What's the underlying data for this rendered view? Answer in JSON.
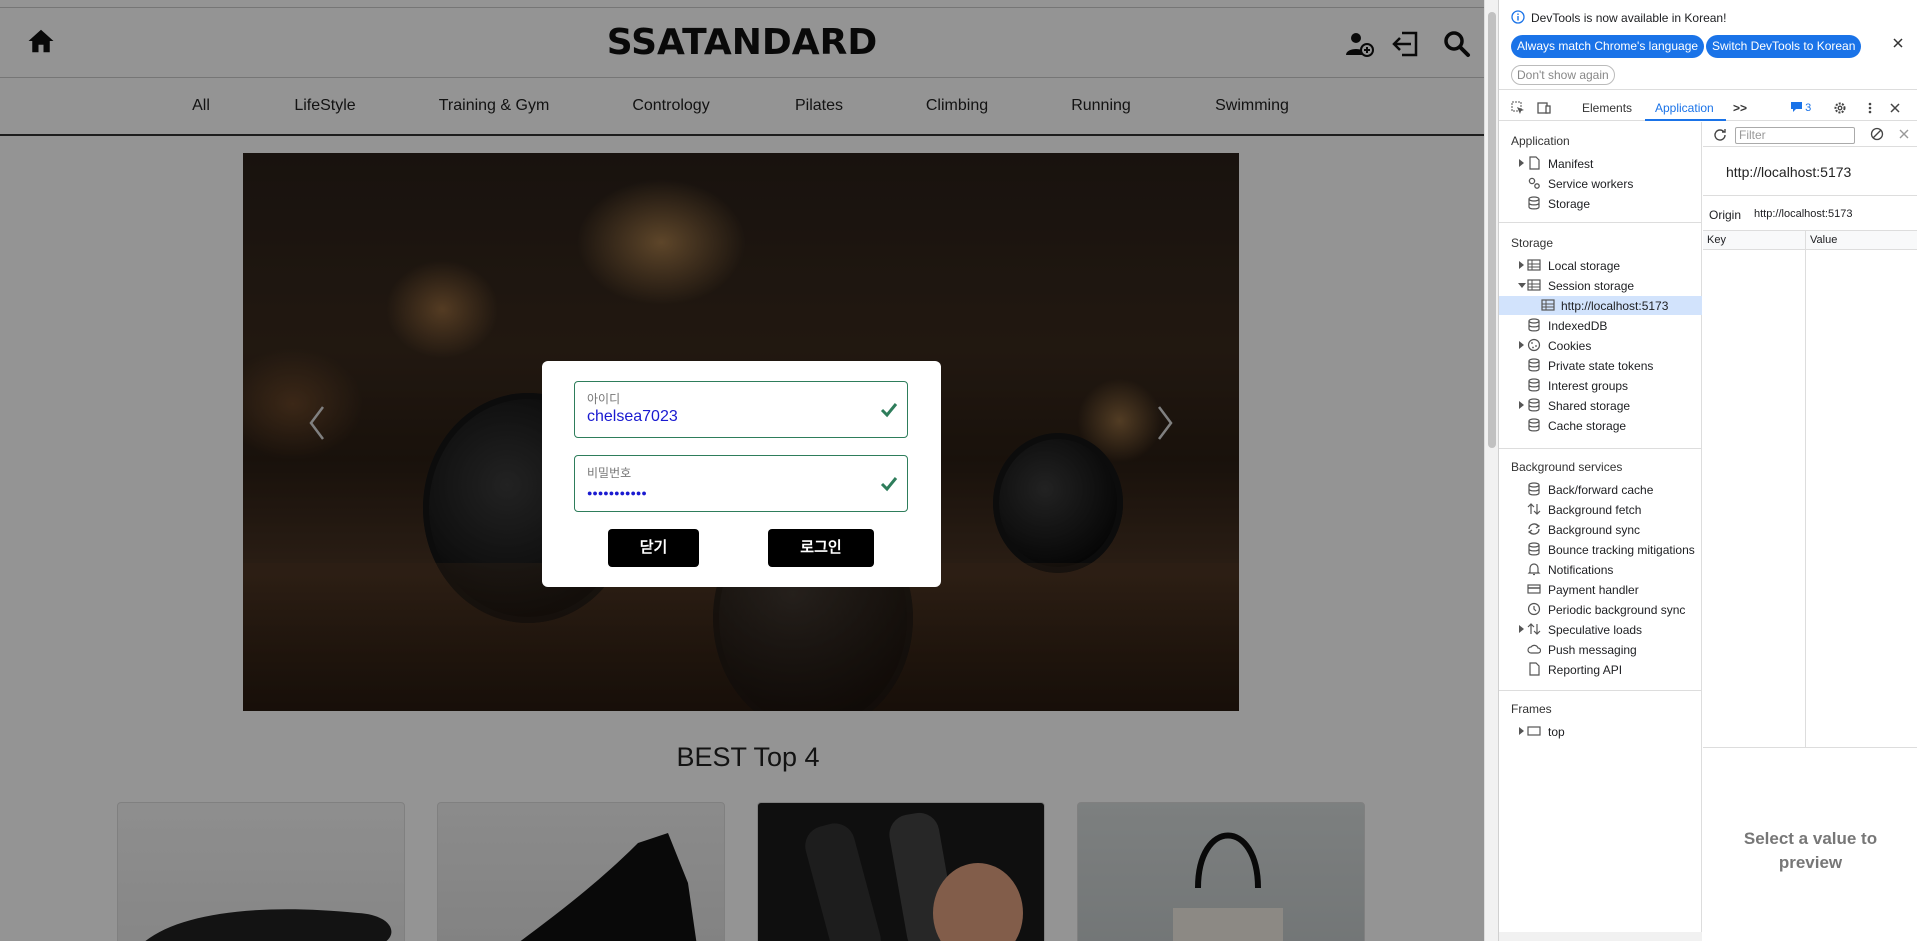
{
  "site": {
    "logo": "SSATANDARD",
    "nav": [
      "All",
      "LifeStyle",
      "Training & Gym",
      "Contrology",
      "Pilates",
      "Climbing",
      "Running",
      "Swimming"
    ],
    "best_title": "BEST Top 4"
  },
  "modal": {
    "id_label": "아이디",
    "id_value": "chelsea7023",
    "pw_label": "비밀번호",
    "pw_value": "●●●●●●●●●●●",
    "close_label": "닫기",
    "login_label": "로그인",
    "accent": "#2e7d5b"
  },
  "devtools": {
    "info_text": "DevTools is now available in Korean!",
    "btn_match": "Always match Chrome's language",
    "btn_switch": "Switch DevTools to Korean",
    "btn_dont_show": "Don't show again",
    "tabs": {
      "elements": "Elements",
      "application": "Application",
      "issues_count": "3"
    },
    "sidebar": {
      "application_title": "Application",
      "application_items": [
        "Manifest",
        "Service workers",
        "Storage"
      ],
      "storage_title": "Storage",
      "storage_items": [
        "Local storage",
        "Session storage",
        "http://localhost:5173",
        "IndexedDB",
        "Cookies",
        "Private state tokens",
        "Interest groups",
        "Shared storage",
        "Cache storage"
      ],
      "bg_title": "Background services",
      "bg_items": [
        "Back/forward cache",
        "Background fetch",
        "Background sync",
        "Bounce tracking mitigations",
        "Notifications",
        "Payment handler",
        "Periodic background sync",
        "Speculative loads",
        "Push messaging",
        "Reporting API"
      ],
      "frames_title": "Frames",
      "frames_items": [
        "top"
      ]
    },
    "panel": {
      "filter_placeholder": "Filter",
      "url": "http://localhost:5173",
      "origin_label": "Origin",
      "origin_value": "http://localhost:5173",
      "col_key": "Key",
      "col_value": "Value",
      "preview_line1": "Select a value to",
      "preview_line2": "preview"
    },
    "accent": "#1a73e8"
  }
}
